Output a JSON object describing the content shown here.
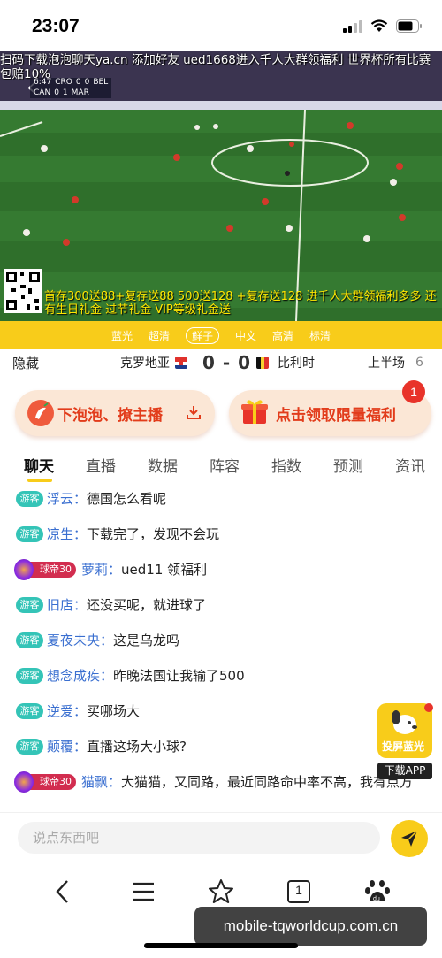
{
  "status_bar": {
    "time": "23:07"
  },
  "video": {
    "marquee_top": "扫码下载泡泡聊天ya.cn 添加好友 ued1668进入千人大群领福利 世界杯所有比赛包赔10%",
    "scoreboard": {
      "clock": "6:47",
      "home_code": "CRO",
      "home_score": "0",
      "away_score": "0",
      "away_code": "BEL",
      "home_code_2": "CAN",
      "home_score_2": "0",
      "away_score_2": "1",
      "away_code_2": "MAR"
    },
    "marquee_bottom": "首存300送88+复存送88 500送128 +复存送128 进千人大群领福利多多 还有生日礼金 过节礼金 VIP等级礼金送"
  },
  "quality_options": [
    "蓝光",
    "超清",
    "鲜子",
    "中文",
    "高清",
    "标清"
  ],
  "quality_selected_index": 2,
  "match": {
    "hide_label": "隐藏",
    "home_team": "克罗地亚",
    "score": "0 - 0",
    "away_team": "比利时",
    "period": "上半场",
    "period_number": "6"
  },
  "promo": {
    "left_label": "下泡泡、撩主播",
    "right_label": "点击领取限量福利",
    "badge_count": "1"
  },
  "tabs": [
    "聊天",
    "直播",
    "数据",
    "阵容",
    "指数",
    "预测",
    "资讯"
  ],
  "active_tab_index": 0,
  "chat": [
    {
      "badge": "游客",
      "name": "浮云：",
      "text": "德国怎么看呢"
    },
    {
      "badge": "游客",
      "name": "凉生：",
      "text": "下载完了，发现不会玩"
    },
    {
      "badge": "球帝30",
      "name": "萝莉：",
      "text": "ued11 领福利"
    },
    {
      "badge": "游客",
      "name": "旧店：",
      "text": "还没买呢，就进球了"
    },
    {
      "badge": "游客",
      "name": "夏夜未央：",
      "text": "这是乌龙吗"
    },
    {
      "badge": "游客",
      "name": "想念成疾：",
      "text": "昨晚法国让我输了500"
    },
    {
      "badge": "游客",
      "name": "逆爱：",
      "text": "买哪场大"
    },
    {
      "badge": "游客",
      "name": "颠覆：",
      "text": "直播这场大小球?"
    },
    {
      "badge": "球帝30",
      "name": "猫飘：",
      "text": "大猫猫，又同路，最近同路命中率不高，我有点方"
    }
  ],
  "cast_widget": {
    "label": "投屏蓝光",
    "download": "下载APP"
  },
  "composer": {
    "placeholder": "说点东西吧"
  },
  "browser": {
    "tab_count": "1",
    "url": "mobile-tqworldcup.com.cn"
  },
  "colors": {
    "accent": "#f8cc1a",
    "promo_text": "#e23c1b",
    "guest_badge": "#34c4b7",
    "level_badge": "#d22d4f",
    "username": "#3a6fd0"
  }
}
